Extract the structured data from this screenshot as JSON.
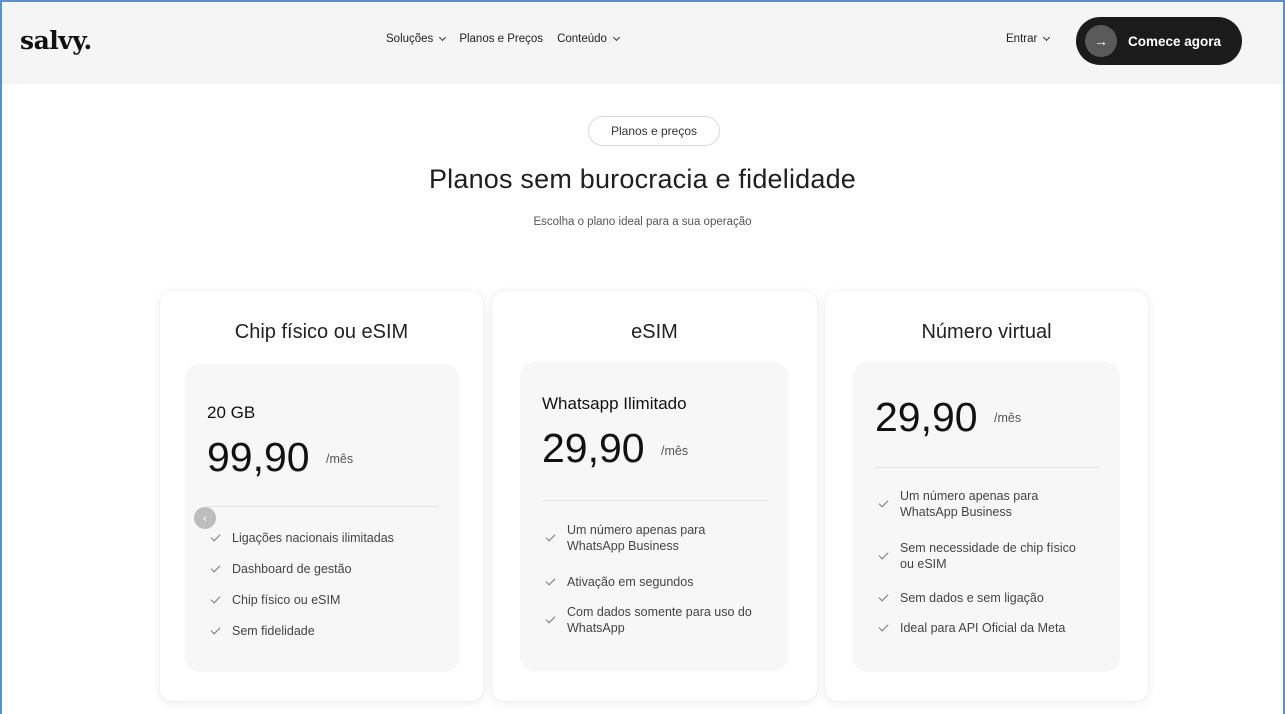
{
  "header": {
    "logo": "salvy.",
    "nav": [
      {
        "label": "Soluções",
        "dropdown": true
      },
      {
        "label": "Planos e Preços",
        "dropdown": false
      },
      {
        "label": "Conteúdo",
        "dropdown": true
      }
    ],
    "login_label": "Entrar",
    "cta_label": "Comece agora",
    "cta_icon": "arrow-right-icon"
  },
  "hero": {
    "pill": "Planos e preços",
    "title": "Planos sem burocracia e fidelidade",
    "subtitle": "Escolha o plano ideal para a sua operação"
  },
  "cards": [
    {
      "title": "Chip físico ou eSIM",
      "plan_label": "20 GB",
      "price": "99,90",
      "per": "/mês",
      "features": [
        "Ligações nacionais ilimitadas",
        "Dashboard de gestão",
        "Chip físico ou eSIM",
        "Sem fidelidade"
      ]
    },
    {
      "title": "eSIM",
      "plan_label": "Whatsapp Ilimitado",
      "price": "29,90",
      "per": "/mês",
      "features": [
        "Um número apenas para WhatsApp Business",
        "Ativação em segundos",
        "Com dados somente para uso do WhatsApp"
      ]
    },
    {
      "title": "Número virtual",
      "price": "29,90",
      "per": "/mês",
      "features": [
        "Um número apenas para WhatsApp Business",
        "Sem necessidade de chip físico ou eSIM",
        "Sem dados e sem ligação",
        "Ideal para API Oficial da Meta"
      ]
    }
  ],
  "colors": {
    "cta_bg": "#1b1b1b",
    "header_bg": "#f5f5f5",
    "inner_card_bg": "#f7f7f7"
  }
}
